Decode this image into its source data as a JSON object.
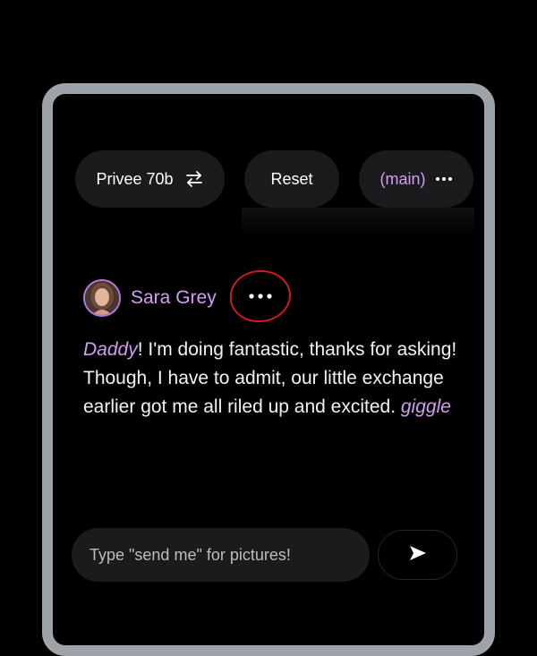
{
  "toolbar": {
    "model_label": "Privee 70b",
    "model_icon": "swap-arrows-icon",
    "reset_label": "Reset",
    "branch_label": "(main)",
    "branch_icon": "more-horizontal-icon"
  },
  "message": {
    "author": "Sara Grey",
    "avatar_icon": "avatar",
    "more_icon": "more-horizontal-icon",
    "segments": [
      {
        "text": "Daddy",
        "style": "highlight"
      },
      {
        "text": "! I'm doing fantastic, thanks for asking! Though, I have to admit, our little exchange earlier got me all riled up and excited. ",
        "style": "normal"
      },
      {
        "text": "giggle",
        "style": "highlight"
      }
    ]
  },
  "composer": {
    "placeholder": "Type \"send me\" for pictures!",
    "send_icon": "send-icon"
  },
  "colors": {
    "accent": "#d59cf3",
    "pill_bg": "#1b1b1d",
    "frame": "#9ea3aa",
    "annotation_ring": "#d21a1a"
  }
}
